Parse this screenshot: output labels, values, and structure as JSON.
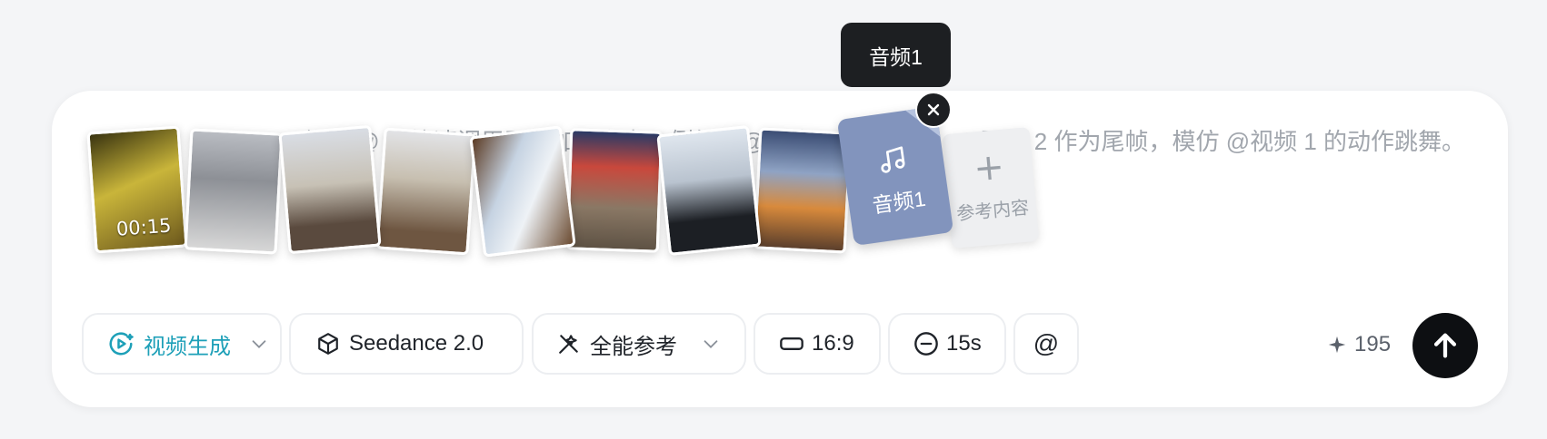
{
  "tooltip": "音频1",
  "prompt": {
    "placeholder": "使用 @ 可快速调用已添加的参考，例如：@图片 1 作为首帧，@图片 2 作为尾帧，模仿 @视频 1 的动作跳舞。"
  },
  "media": [
    {
      "kind": "video",
      "duration": "00:15",
      "icon": "video-thumbnail"
    },
    {
      "kind": "image",
      "icon": "robot-image-thumbnail"
    },
    {
      "kind": "image",
      "icon": "cathedral-selfie-thumbnail"
    },
    {
      "kind": "image",
      "icon": "street-icecream-thumbnail"
    },
    {
      "kind": "image",
      "icon": "train-window-thumbnail"
    },
    {
      "kind": "image",
      "icon": "olympic-fan-thumbnail"
    },
    {
      "kind": "image",
      "icon": "ski-goggles-thumbnail"
    },
    {
      "kind": "image",
      "icon": "christmas-market-thumbnail"
    }
  ],
  "audio_card": {
    "label": "音频1",
    "icon": "music-note-icon"
  },
  "add_card": {
    "label": "参考内容"
  },
  "toolbar": {
    "mode": {
      "label": "视频生成",
      "color": "#1ea0b8"
    },
    "model": {
      "label": "Seedance 2.0"
    },
    "reference": {
      "label": "全能参考"
    },
    "ratio": {
      "label": "16:9"
    },
    "duration": {
      "label": "15s"
    },
    "mention": {
      "label": "@"
    }
  },
  "credits": {
    "value": "195"
  },
  "colors": {
    "accent": "#1ea0b8",
    "send": "#0d0f12",
    "audio_card": "#8294bd"
  }
}
